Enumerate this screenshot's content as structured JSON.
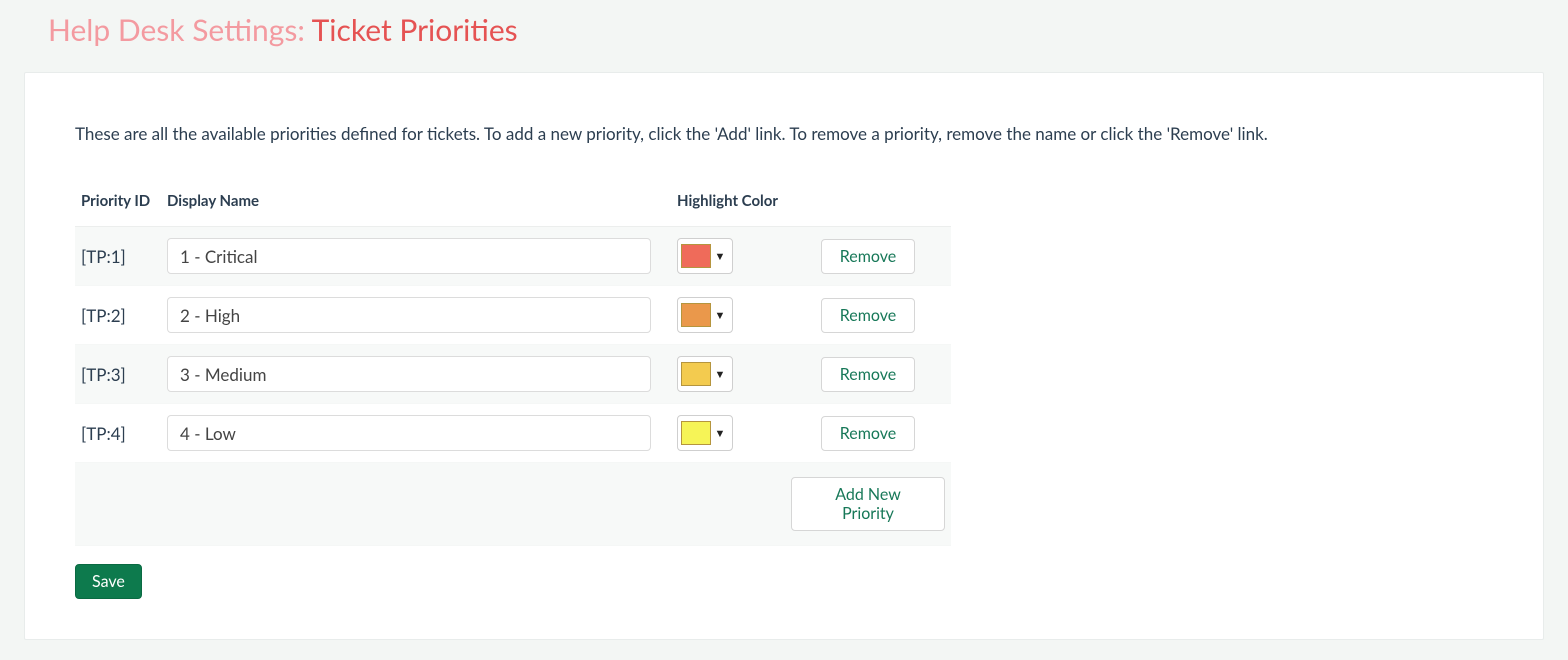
{
  "header": {
    "prefix": "Help Desk Settings:",
    "main": "Ticket Priorities"
  },
  "description": "These are all the available priorities defined for tickets. To add a new priority, click the 'Add' link. To remove a priority, remove the name or click the 'Remove' link.",
  "columns": {
    "priority_id": "Priority ID",
    "display_name": "Display Name",
    "highlight_color": "Highlight Color"
  },
  "rows": [
    {
      "id_label": "[TP:1]",
      "name": "1 - Critical",
      "color": "#ef6b5a"
    },
    {
      "id_label": "[TP:2]",
      "name": "2 - High",
      "color": "#ea984b"
    },
    {
      "id_label": "[TP:3]",
      "name": "3 - Medium",
      "color": "#f3cb4f"
    },
    {
      "id_label": "[TP:4]",
      "name": "4 - Low",
      "color": "#f6f457"
    }
  ],
  "buttons": {
    "remove": "Remove",
    "add": "Add New Priority",
    "save": "Save"
  }
}
